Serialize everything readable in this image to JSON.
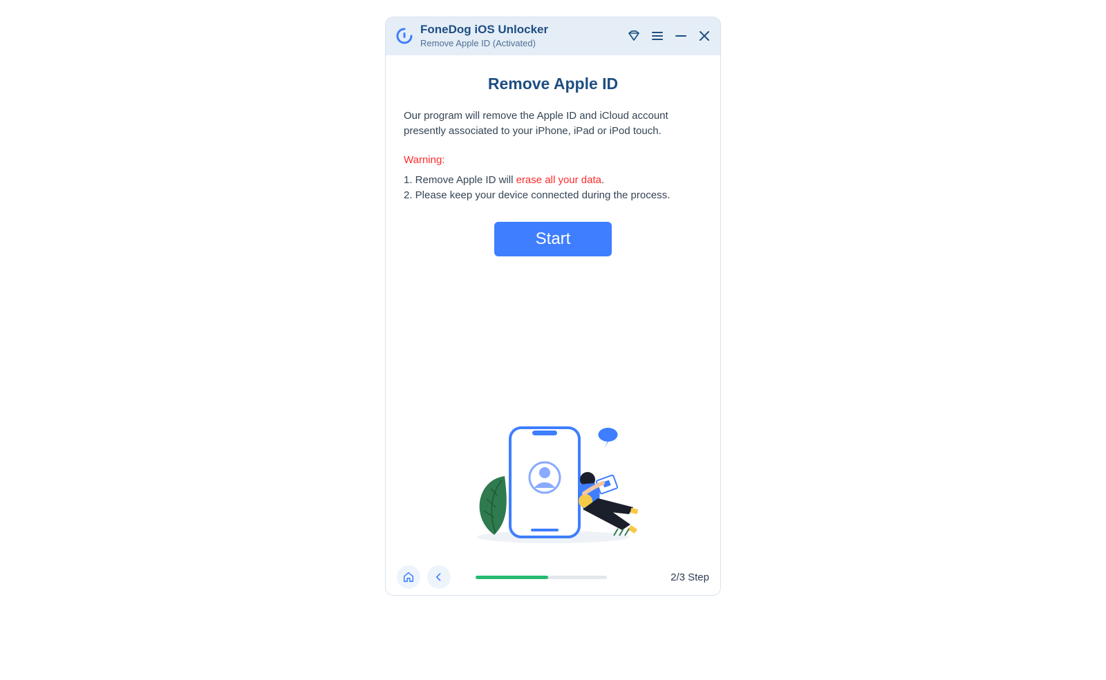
{
  "header": {
    "app_title": "FoneDog iOS Unlocker",
    "subtitle": "Remove Apple ID  (Activated)"
  },
  "main": {
    "title": "Remove Apple ID",
    "description": "Our program will remove the Apple ID and iCloud account presently associated to your iPhone, iPad or iPod touch.",
    "warning_label": "Warning:",
    "warning_1_prefix": "1. Remove Apple ID will ",
    "warning_1_highlight": "erase all your data",
    "warning_1_suffix": ".",
    "warning_2": "2. Please keep your device connected during the process.",
    "start_button": "Start"
  },
  "footer": {
    "step_label": "2/3 Step",
    "progress_percent": 55
  },
  "colors": {
    "accent": "#3e7eff",
    "brand_dark": "#1e4e82",
    "danger": "#ff2b2b",
    "progress": "#27b96f"
  }
}
